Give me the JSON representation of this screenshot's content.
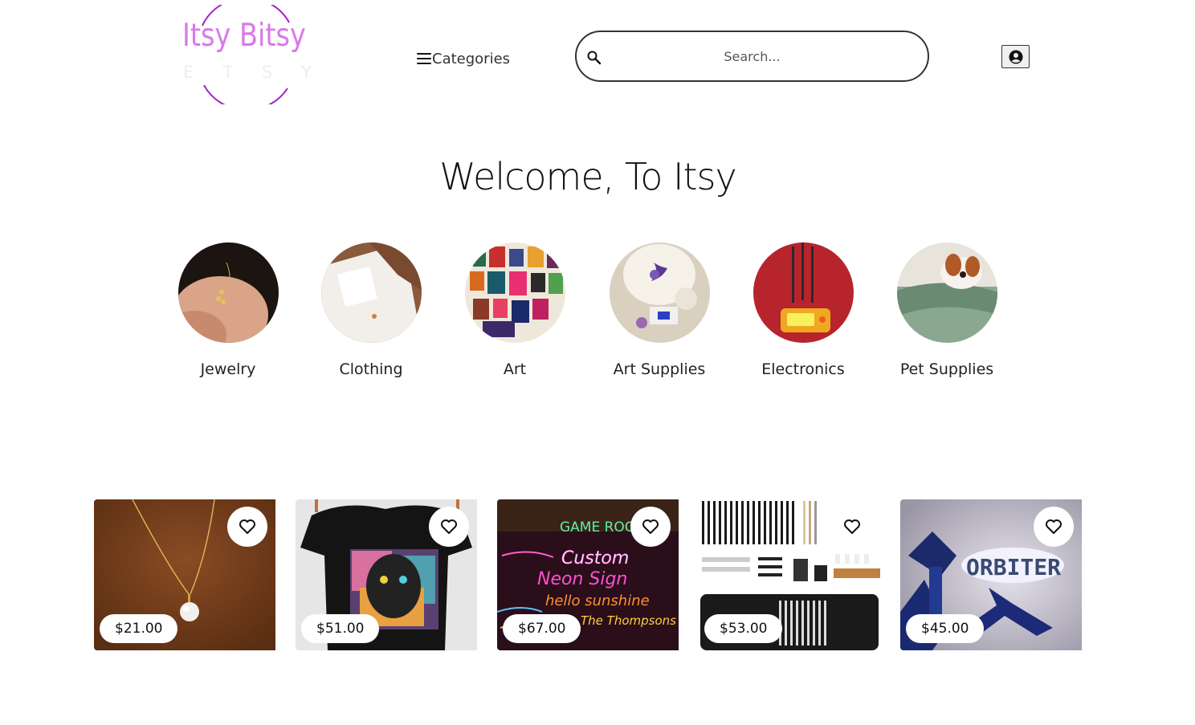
{
  "logo": {
    "title": "Itsy Bitsy",
    "letters": [
      "E",
      "T",
      "S",
      "Y"
    ]
  },
  "nav": {
    "categories_label": "Categories"
  },
  "search": {
    "placeholder": "Search..."
  },
  "welcome": {
    "heading": "Welcome, To Itsy"
  },
  "categories": [
    {
      "label": "Jewelry"
    },
    {
      "label": "Clothing"
    },
    {
      "label": "Art"
    },
    {
      "label": "Art Supplies"
    },
    {
      "label": "Electronics"
    },
    {
      "label": "Pet Supplies"
    }
  ],
  "products": [
    {
      "price": "$21.00"
    },
    {
      "price": "$51.00"
    },
    {
      "price": "$67.00"
    },
    {
      "price": "$53.00"
    },
    {
      "price": "$45.00"
    }
  ],
  "neon": {
    "line1": "GAME ROOM",
    "line2": "Custom",
    "line3": "Neon Sign",
    "line4": "hello sunshine",
    "line5": "The Thompsons"
  },
  "orbiter": {
    "text": "ORBITER"
  },
  "colors": {
    "logo_pink": "#d87ae8",
    "logo_ring": "#a020c8"
  },
  "icons": {
    "search": "search-icon",
    "hamburger": "hamburger-icon",
    "account": "user-circle-icon",
    "favorite": "heart-icon"
  }
}
